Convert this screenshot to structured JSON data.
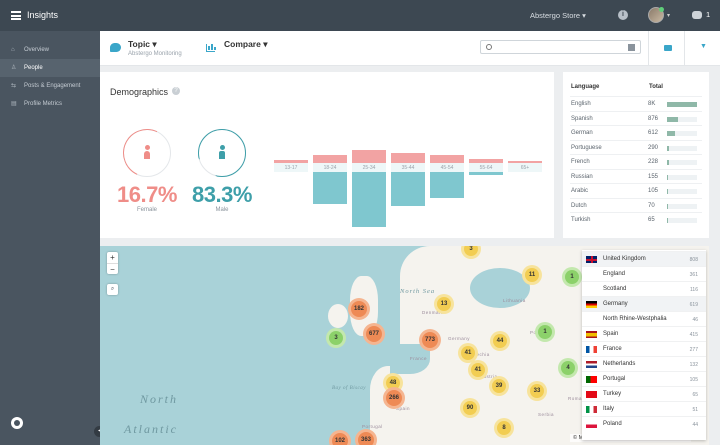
{
  "topbar": {
    "title": "Insights",
    "store": "Abstergo Store ▾",
    "info_icon": "i",
    "avatar_caret": "▾",
    "notifications": "1"
  },
  "sidebar": {
    "items": [
      {
        "label": "Overview",
        "icon": "home-icon",
        "glyph": "⌂",
        "active": false
      },
      {
        "label": "People",
        "icon": "person-icon",
        "glyph": "♙",
        "active": true
      },
      {
        "label": "Posts & Engagement",
        "icon": "posts-icon",
        "glyph": "⇆",
        "active": false
      },
      {
        "label": "Profile Metrics",
        "icon": "metrics-icon",
        "glyph": "▤",
        "active": false
      }
    ],
    "collapse_glyph": "◂"
  },
  "subbar": {
    "topic_label": "Topic ▾",
    "topic_sub": "Abstergo Monitoring",
    "compare_label": "Compare ▾",
    "search_placeholder": "",
    "dropdown_glyph": "▼"
  },
  "demographics": {
    "title": "Demographics",
    "help": "?",
    "female": {
      "percent": "16.7%",
      "label": "Female",
      "color": "#ef8d88"
    },
    "male": {
      "percent": "83.3%",
      "label": "Male",
      "color": "#3e9fa9"
    },
    "age_groups": [
      {
        "label": "13-17",
        "female": 0.03,
        "male": 0.0
      },
      {
        "label": "18-24",
        "female": 0.09,
        "male": 0.53
      },
      {
        "label": "25-34",
        "female": 0.14,
        "male": 0.92
      },
      {
        "label": "35-44",
        "female": 0.11,
        "male": 0.56
      },
      {
        "label": "45-54",
        "female": 0.09,
        "male": 0.44
      },
      {
        "label": "55-64",
        "female": 0.04,
        "male": 0.05
      },
      {
        "label": "65+",
        "female": 0.01,
        "male": 0.0
      }
    ]
  },
  "languages": {
    "header_language": "Language",
    "header_total": "Total",
    "rows": [
      {
        "name": "English",
        "total": "8K",
        "share": 1.0
      },
      {
        "name": "Spanish",
        "total": "876",
        "share": 0.35
      },
      {
        "name": "German",
        "total": "612",
        "share": 0.25
      },
      {
        "name": "Portuguese",
        "total": "290",
        "share": 0.07
      },
      {
        "name": "French",
        "total": "228",
        "share": 0.06
      },
      {
        "name": "Russian",
        "total": "155",
        "share": 0.04
      },
      {
        "name": "Arabic",
        "total": "105",
        "share": 0.03
      },
      {
        "name": "Dutch",
        "total": "70",
        "share": 0.02
      },
      {
        "name": "Turkish",
        "total": "65",
        "share": 0.02
      }
    ]
  },
  "map": {
    "zoom_in": "+",
    "zoom_out": "−",
    "search_glyph": "⌕",
    "ocean_label_1": "North",
    "ocean_label_2": "Atlantic",
    "sea_label": "North Sea",
    "bay_label": "Bay of Biscay",
    "place_labels": [
      "Denmark",
      "Lithuania",
      "Belarus",
      "Poland",
      "Germany",
      "Czechia",
      "Austria",
      "Serbia",
      "Romania",
      "France",
      "Spain",
      "Portugal"
    ],
    "attribution": "© Mapbox © OpenStreetMap Improve this map",
    "clusters": [
      {
        "label": "3",
        "tone": "y"
      },
      {
        "label": "11",
        "tone": "y"
      },
      {
        "label": "1",
        "tone": "g"
      },
      {
        "label": "182",
        "tone": "o"
      },
      {
        "label": "13",
        "tone": "y"
      },
      {
        "label": "3",
        "tone": "g"
      },
      {
        "label": "677",
        "tone": "o"
      },
      {
        "label": "773",
        "tone": "o"
      },
      {
        "label": "44",
        "tone": "y"
      },
      {
        "label": "1",
        "tone": "g"
      },
      {
        "label": "41",
        "tone": "y"
      },
      {
        "label": "41",
        "tone": "y"
      },
      {
        "label": "4",
        "tone": "g"
      },
      {
        "label": "48",
        "tone": "y"
      },
      {
        "label": "39",
        "tone": "y"
      },
      {
        "label": "266",
        "tone": "o"
      },
      {
        "label": "33",
        "tone": "y"
      },
      {
        "label": "90",
        "tone": "y"
      },
      {
        "label": "102",
        "tone": "o"
      },
      {
        "label": "363",
        "tone": "o"
      },
      {
        "label": "8",
        "tone": "y"
      }
    ]
  },
  "countries": [
    {
      "name": "United Kingdom",
      "value": "808",
      "flag": "uk",
      "sub": false
    },
    {
      "name": "England",
      "value": "361",
      "flag": "",
      "sub": true
    },
    {
      "name": "Scotland",
      "value": "116",
      "flag": "",
      "sub": true
    },
    {
      "name": "Germany",
      "value": "619",
      "flag": "de",
      "sub": false
    },
    {
      "name": "North Rhine-Westphalia",
      "value": "46",
      "flag": "",
      "sub": true
    },
    {
      "name": "Spain",
      "value": "415",
      "flag": "es",
      "sub": false
    },
    {
      "name": "France",
      "value": "277",
      "flag": "fr",
      "sub": false
    },
    {
      "name": "Netherlands",
      "value": "132",
      "flag": "nl",
      "sub": false
    },
    {
      "name": "Portugal",
      "value": "105",
      "flag": "pt",
      "sub": false
    },
    {
      "name": "Turkey",
      "value": "65",
      "flag": "tr",
      "sub": false
    },
    {
      "name": "Italy",
      "value": "51",
      "flag": "it",
      "sub": false
    },
    {
      "name": "Poland",
      "value": "44",
      "flag": "pl",
      "sub": false
    }
  ]
}
